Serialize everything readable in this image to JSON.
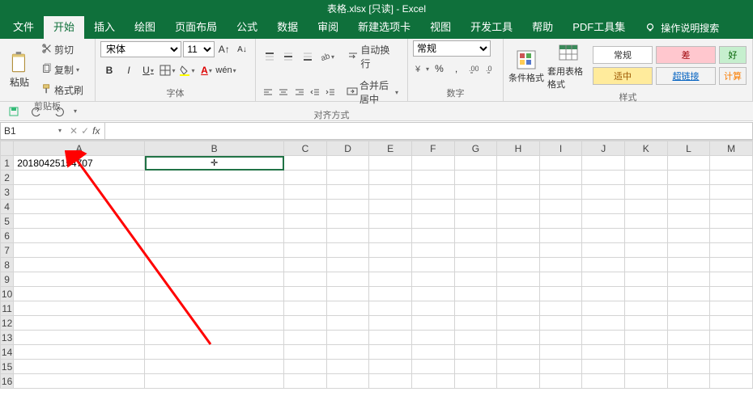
{
  "titlebar": {
    "text": "表格.xlsx [只读] - Excel"
  },
  "menu": {
    "file": "文件",
    "home": "开始",
    "insert": "插入",
    "draw": "绘图",
    "layout": "页面布局",
    "formula": "公式",
    "data": "数据",
    "review": "审阅",
    "newtab": "新建选项卡",
    "view": "视图",
    "dev": "开发工具",
    "help": "帮助",
    "pdf": "PDF工具集",
    "search": "操作说明搜索"
  },
  "clipboard": {
    "paste": "粘贴",
    "cut": "剪切",
    "copy": "复制",
    "painter": "格式刷",
    "label": "剪贴板"
  },
  "font": {
    "name": "宋体",
    "size": "11",
    "label": "字体"
  },
  "align": {
    "wrap": "自动换行",
    "merge": "合并后居中",
    "label": "对齐方式"
  },
  "number": {
    "format": "常规",
    "label": "数字"
  },
  "styles": {
    "cond": "条件格式",
    "table": "套用表格格式",
    "normal": "常规",
    "bad": "差",
    "good": "好",
    "neutral": "适中",
    "link": "超链接",
    "calc": "计算",
    "label": "样式"
  },
  "namebox": "B1",
  "cellA1": "20180425154707",
  "columns": [
    "A",
    "B",
    "C",
    "D",
    "E",
    "F",
    "G",
    "H",
    "I",
    "J",
    "K",
    "L",
    "M"
  ],
  "rows": [
    "1",
    "2",
    "3",
    "4",
    "5",
    "6",
    "7",
    "8",
    "9",
    "10",
    "11",
    "12",
    "13",
    "14",
    "15",
    "16"
  ]
}
